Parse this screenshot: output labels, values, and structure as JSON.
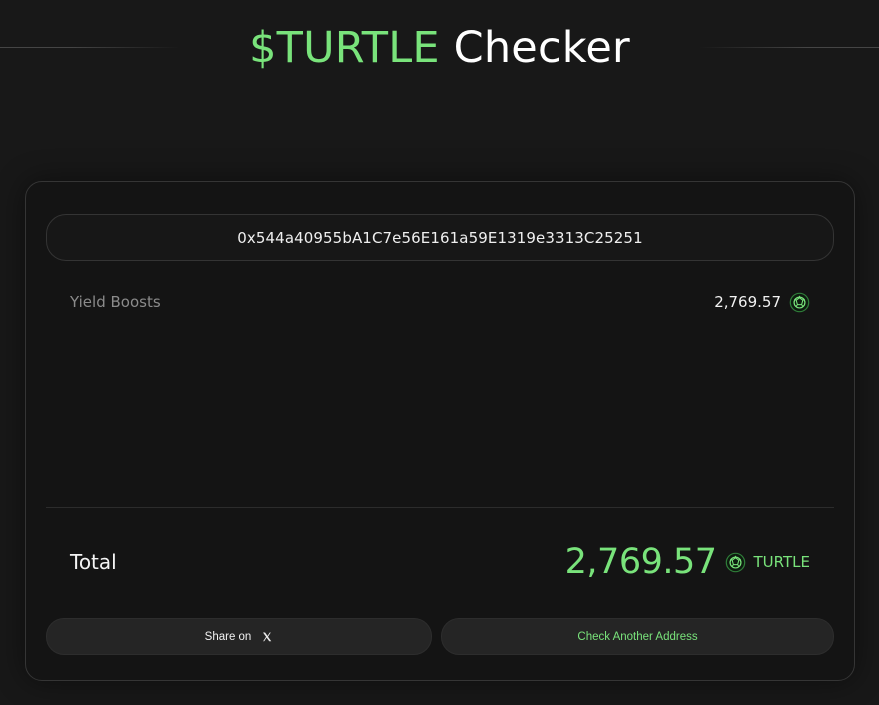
{
  "header": {
    "title_accent": "$TURTLE",
    "title_rest": "Checker"
  },
  "address": {
    "value": "0x544a40955bA1C7e56E161a59E1319e3313C25251"
  },
  "breakdown": {
    "items": [
      {
        "label": "Yield Boosts",
        "value": "2,769.57",
        "icon": "turtle-token-icon"
      }
    ]
  },
  "total": {
    "label": "Total",
    "value": "2,769.57",
    "token": "TURTLE",
    "icon": "turtle-token-icon"
  },
  "actions": {
    "share_label": "Share on",
    "share_icon": "x-icon",
    "check_label": "Check Another Address"
  },
  "colors": {
    "accent": "#79e37b",
    "background": "#181818",
    "card": "#141414"
  }
}
